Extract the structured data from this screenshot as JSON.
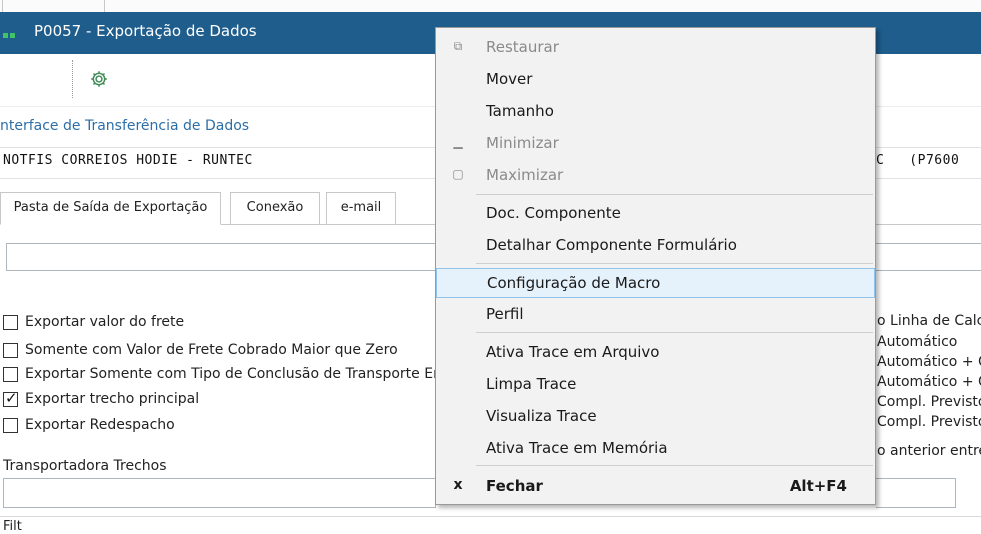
{
  "window": {
    "title": "P0057 - Exportação de Dados"
  },
  "section": {
    "header": "nterface de Transferência de Dados",
    "interface_value": "NOTFIS CORREIOS HODIE - RUNTEC",
    "interface_value_right": "C   (P7600"
  },
  "tabs": [
    {
      "label": "Pasta de Saída de Exportação"
    },
    {
      "label": "Conexão"
    },
    {
      "label": "e-mail"
    }
  ],
  "options": [
    {
      "label": "Exportar valor do frete",
      "checked": false
    },
    {
      "label": "Somente com Valor de Frete Cobrado Maior que Zero",
      "checked": false
    },
    {
      "label": "Exportar Somente com Tipo de Conclusão de Transporte Er",
      "checked": false
    },
    {
      "label": "Exportar trecho principal",
      "checked": true
    },
    {
      "label": "Exportar Redespacho",
      "checked": false
    }
  ],
  "right_labels": [
    "o Linha de Calc",
    "Automático",
    "Automático + C",
    "Automático + C",
    "Compl. Previsto",
    "Compl. Previsto",
    "o anterior entreg"
  ],
  "carrier": {
    "label": "Transportadora Trechos"
  },
  "filter": {
    "label": "Filt"
  },
  "context_menu": {
    "items": [
      {
        "label": "Restaurar",
        "icon": "restore-icon",
        "disabled": true
      },
      {
        "label": "Mover",
        "disabled": false
      },
      {
        "label": "Tamanho",
        "disabled": false
      },
      {
        "label": "Minimizar",
        "icon": "minimize-icon",
        "disabled": true
      },
      {
        "label": "Maximizar",
        "icon": "maximize-icon",
        "disabled": true
      },
      {
        "label": "Doc. Componente",
        "disabled": false
      },
      {
        "label": "Detalhar Componente Formulário",
        "disabled": false
      },
      {
        "label": "Configuração de Macro",
        "disabled": false,
        "highlighted": true
      },
      {
        "label": "Perfil",
        "disabled": false
      },
      {
        "label": "Ativa Trace em Arquivo",
        "disabled": false
      },
      {
        "label": "Limpa Trace",
        "disabled": false
      },
      {
        "label": "Visualiza Trace",
        "disabled": false
      },
      {
        "label": "Ativa Trace em Memória",
        "disabled": false
      },
      {
        "label": "Fechar",
        "icon": "close-icon",
        "shortcut": "Alt+F4",
        "bold": true
      }
    ]
  },
  "colors": {
    "titlebar": "#1f5d8c",
    "section_header": "#2d6ea8",
    "menu_highlight": "#e5f1fb"
  }
}
